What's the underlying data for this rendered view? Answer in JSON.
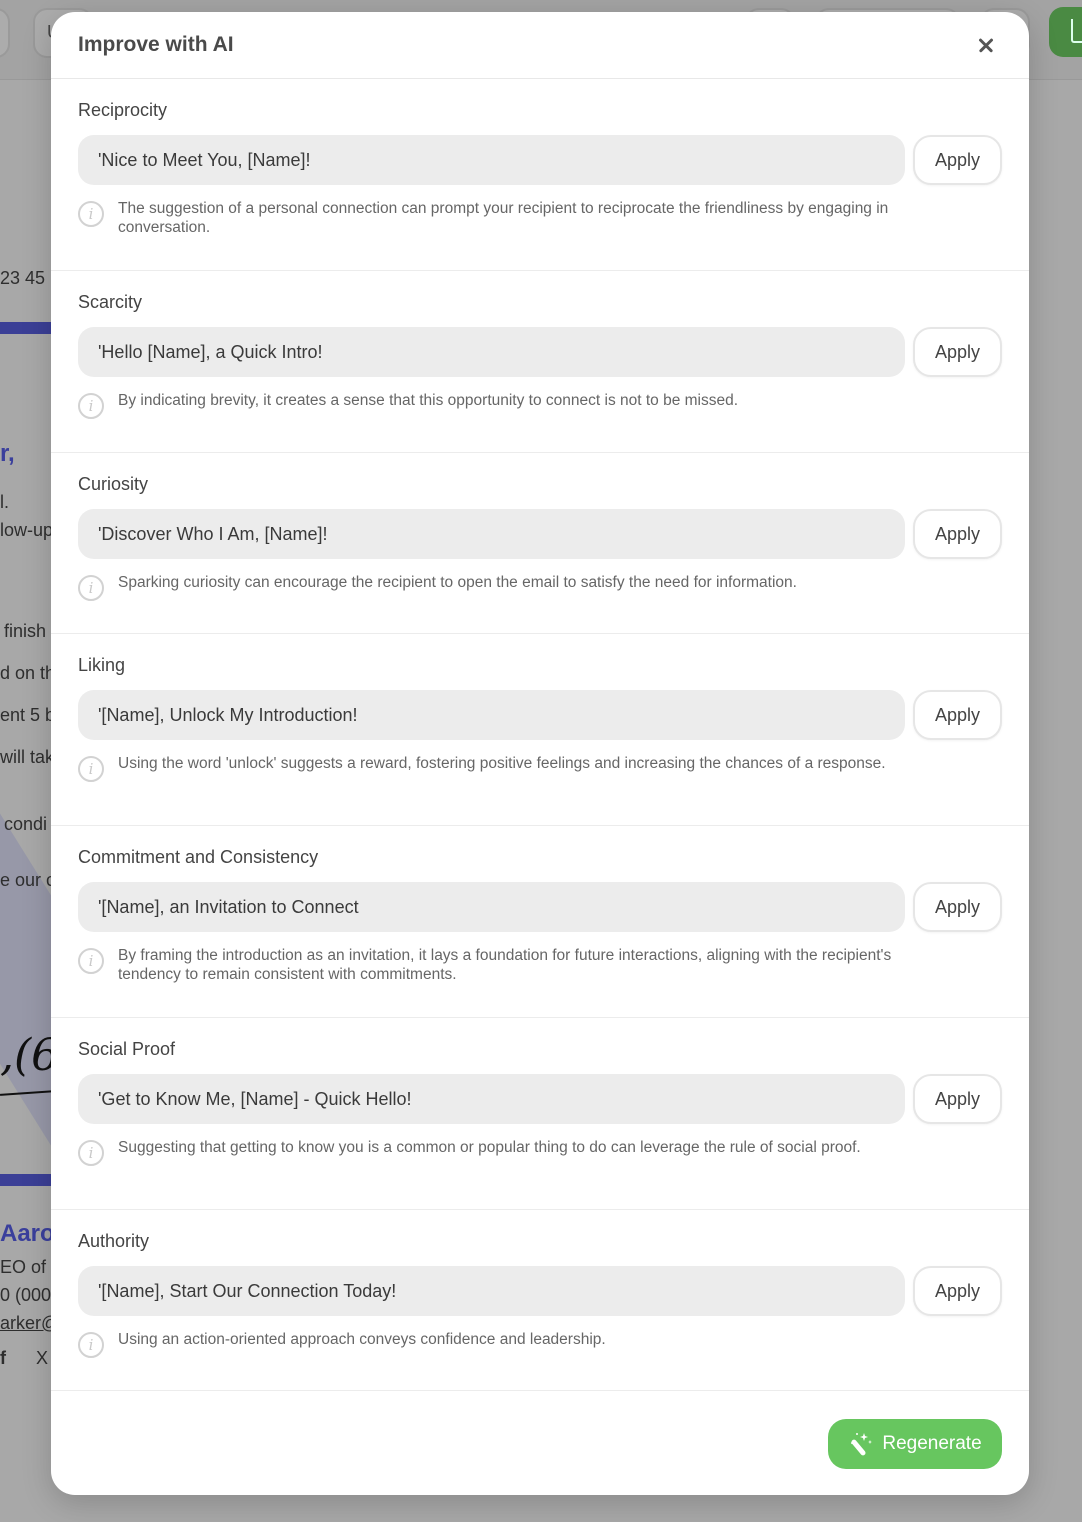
{
  "background": {
    "toolbar_partial_label": "U",
    "fragments": {
      "phone_partial": "23 45",
      "greeting_partial": "r,",
      "line1_partial": "l.",
      "line2_partial": "low-up",
      "line3_partial": "finish",
      "line4_partial": "d on th",
      "line5_partial": "ent 5 b",
      "line6_partial": "will tak",
      "line7_partial": "condi",
      "line8_partial": "e our c",
      "signature_partial": ",(6",
      "name_partial": "Aaron",
      "title_partial": "EO of",
      "phone2_partial": "0 (000",
      "email_partial": "arker@"
    },
    "colors": {
      "accent_blue": "#3b3f96",
      "share_green": "#4a8a43"
    }
  },
  "modal": {
    "title": "Improve with AI",
    "close_label": "Close",
    "apply_label": "Apply",
    "sections": [
      {
        "title": "Reciprocity",
        "suggestion": "'Nice to Meet You, [Name]!",
        "hint": "The suggestion of a personal connection can prompt your recipient to reciprocate the friendliness by engaging in conversation."
      },
      {
        "title": "Scarcity",
        "suggestion": "'Hello [Name], a Quick Intro!",
        "hint": "By indicating brevity, it creates a sense that this opportunity to connect is not to be missed."
      },
      {
        "title": "Curiosity",
        "suggestion": "'Discover Who I Am, [Name]!",
        "hint": "Sparking curiosity can encourage the recipient to open the email to satisfy the need for information."
      },
      {
        "title": "Liking",
        "suggestion": "'[Name], Unlock My Introduction!",
        "hint": "Using the word 'unlock' suggests a reward, fostering positive feelings and increasing the chances of a response."
      },
      {
        "title": "Commitment and Consistency",
        "suggestion": "'[Name], an Invitation to Connect",
        "hint": "By framing the introduction as an invitation, it lays a foundation for future interactions, aligning with the recipient's tendency to remain consistent with commitments."
      },
      {
        "title": "Social Proof",
        "suggestion": "'Get to Know Me, [Name] - Quick Hello!",
        "hint": "Suggesting that getting to know you is a common or popular thing to do can leverage the rule of social proof."
      },
      {
        "title": "Authority",
        "suggestion": "'[Name], Start Our Connection Today!",
        "hint": "Using an action-oriented approach conveys confidence and leadership."
      }
    ],
    "footer": {
      "regenerate_label": "Regenerate",
      "regenerate_color": "#67c65f"
    },
    "icons": {
      "info": "i",
      "close": "x-icon",
      "regenerate": "magic-wand-icon"
    }
  }
}
